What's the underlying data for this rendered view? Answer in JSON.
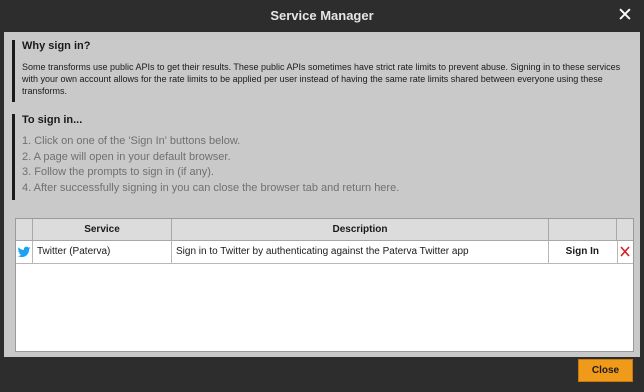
{
  "window": {
    "title": "Service Manager"
  },
  "intro": {
    "title": "Why sign in?",
    "text": "Some transforms use public APIs to get their results. These public APIs sometimes have strict rate limits to prevent abuse. Signing in to these services with your own account allows for the rate limits to be applied per user instead of having the same rate limits shared between everyone using these transforms."
  },
  "howto": {
    "title": "To sign in...",
    "steps": [
      "1.  Click on one of the 'Sign In' buttons below.",
      "2.  A page will open in your default browser.",
      "3.  Follow the prompts to sign in (if any).",
      "4.  After successfully signing in you can close the browser tab and return here."
    ]
  },
  "table": {
    "headers": {
      "service": "Service",
      "description": "Description"
    },
    "rows": [
      {
        "icon": "twitter-bird-icon",
        "service": "Twitter (Paterva)",
        "description": "Sign in to Twitter by authenticating against the Paterva Twitter app",
        "action": "Sign In",
        "delete_icon": "delete-x-icon"
      }
    ]
  },
  "footer": {
    "close_label": "Close"
  },
  "colors": {
    "accent": "#f09a1a",
    "twitter": "#1da1f2",
    "delete": "#d42020"
  }
}
